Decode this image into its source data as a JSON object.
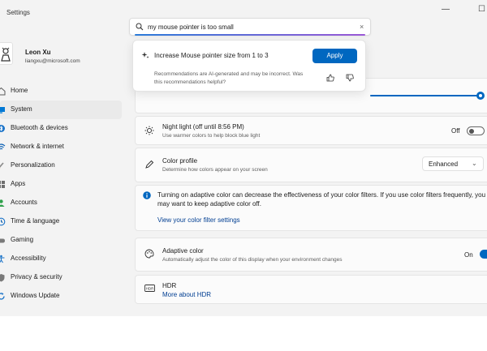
{
  "window": {
    "title": "Settings",
    "minimize": "—",
    "maximize": "☐"
  },
  "profile": {
    "name": "Leon Xu",
    "email": "liangxu@microsoft.com"
  },
  "nav": [
    {
      "label": "Home",
      "icon": "home-icon",
      "selected": false
    },
    {
      "label": "System",
      "icon": "system-icon",
      "selected": true
    },
    {
      "label": "Bluetooth & devices",
      "icon": "bluetooth-icon",
      "selected": false
    },
    {
      "label": "Network & internet",
      "icon": "network-icon",
      "selected": false
    },
    {
      "label": "Personalization",
      "icon": "brush-icon",
      "selected": false
    },
    {
      "label": "Apps",
      "icon": "apps-icon",
      "selected": false
    },
    {
      "label": "Accounts",
      "icon": "person-icon",
      "selected": false
    },
    {
      "label": "Time & language",
      "icon": "globe-clock-icon",
      "selected": false
    },
    {
      "label": "Gaming",
      "icon": "controller-icon",
      "selected": false
    },
    {
      "label": "Accessibility",
      "icon": "accessibility-icon",
      "selected": false
    },
    {
      "label": "Privacy & security",
      "icon": "shield-icon",
      "selected": false
    },
    {
      "label": "Windows Update",
      "icon": "update-icon",
      "selected": false
    }
  ],
  "search": {
    "value": "my mouse pointer is too small",
    "clear": "×"
  },
  "recommendation": {
    "title": "Increase Mouse pointer size from 1 to 3",
    "apply_label": "Apply",
    "note_line1": "Recommendations are AI-generated and may be incorrect. Was",
    "note_line2": "this recommendations helpful?"
  },
  "brightness": {
    "level": 1.0
  },
  "night_light": {
    "title": "Night light (off until 8:56 PM)",
    "description": "Use warmer colors to help block blue light",
    "state_label": "Off",
    "on": false
  },
  "color_profile": {
    "title": "Color profile",
    "description": "Determine how colors appear on your screen",
    "selected": "Enhanced"
  },
  "info": {
    "line1": "Turning on adaptive color can decrease the effectiveness of your color filters. If you use color filters frequently, you",
    "line2": "may want to keep adaptive color off.",
    "link": "View your color filter settings"
  },
  "adaptive_color": {
    "title": "Adaptive color",
    "description": "Automatically adjust the color of this display when your environment changes",
    "state_label": "On",
    "on": true
  },
  "hdr": {
    "title": "HDR",
    "link": "More about HDR"
  },
  "colors": {
    "accent": "#0067c0",
    "link": "#003e92"
  }
}
